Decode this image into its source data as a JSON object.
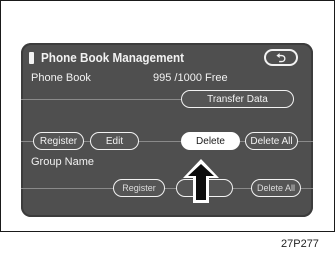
{
  "screen": {
    "title": "Phone Book Management",
    "back_icon": "return-arrow-icon",
    "phone_book_label": "Phone Book",
    "phone_book_count": "995 /1000 Free",
    "group_name_label": "Group Name"
  },
  "buttons": {
    "transfer_data": "Transfer Data",
    "register": "Register",
    "edit": "Edit",
    "delete": "Delete",
    "delete_all": "Delete All",
    "group_register": "Register",
    "group_delete_all": "Delete All"
  },
  "indicator": {
    "icon": "up-arrow-pointer-icon",
    "target": "Delete"
  },
  "figure_code": "27P277",
  "colors": {
    "screen_bg": "#4f4f4f",
    "text": "#f2f2f2",
    "highlight": "#ffffff"
  }
}
